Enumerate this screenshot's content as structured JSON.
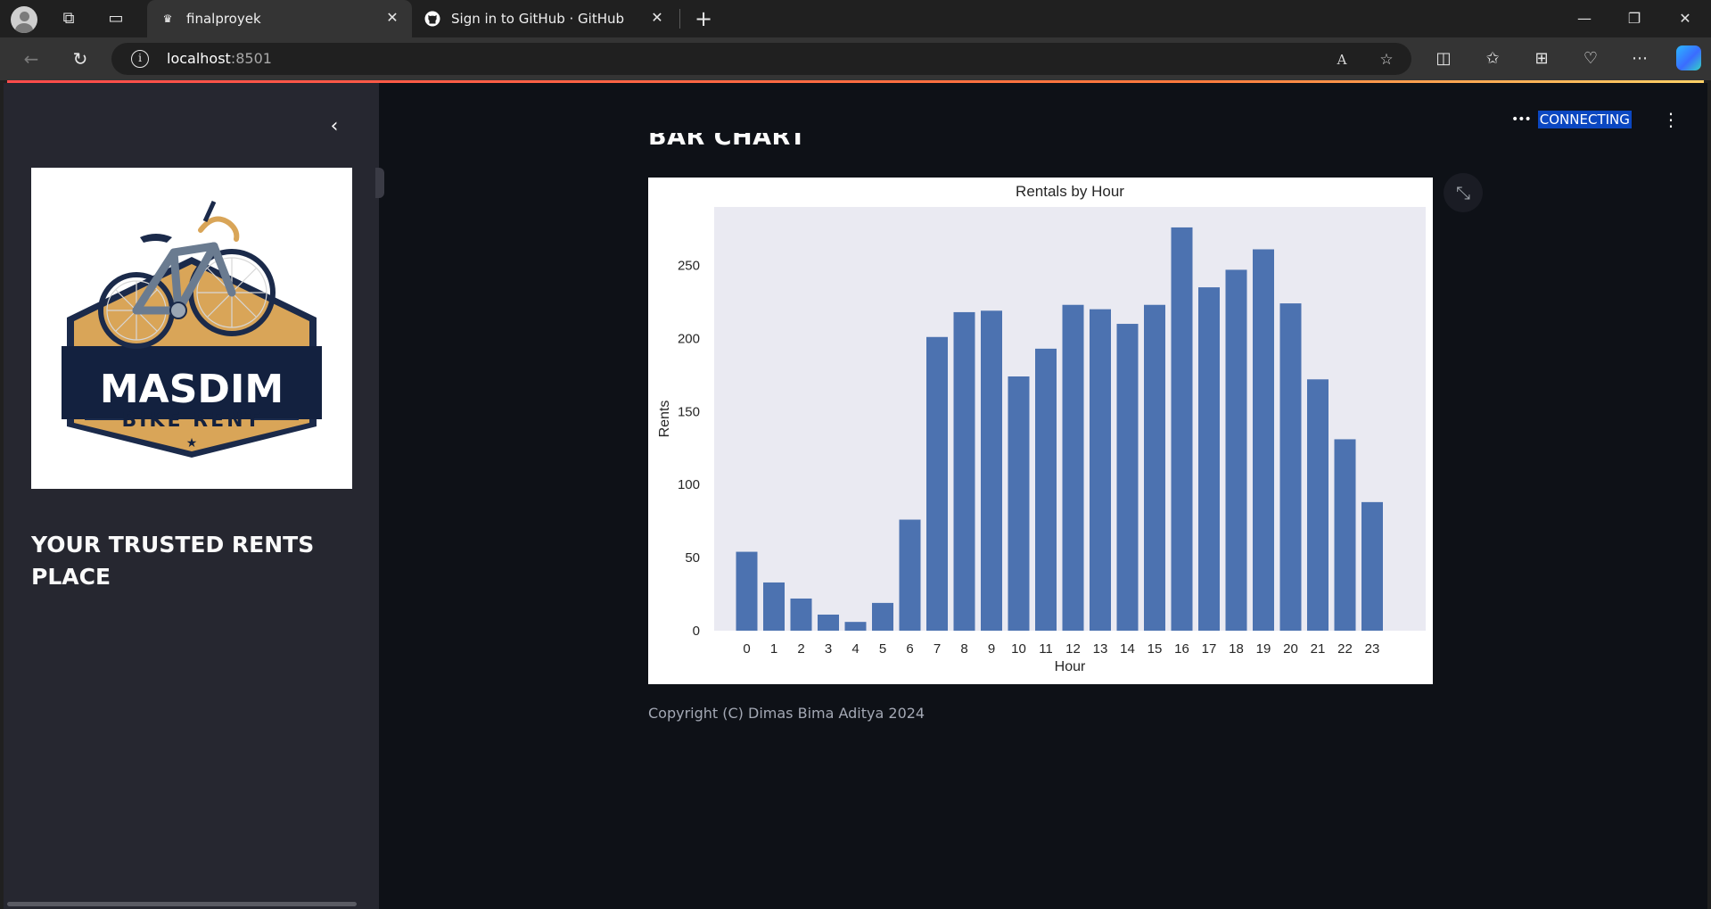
{
  "browser": {
    "tabs": [
      {
        "title": "finalproyek",
        "active": true
      },
      {
        "title": "Sign in to GitHub · GitHub",
        "active": false
      }
    ],
    "address": {
      "host": "localhost",
      "port": ":8501"
    }
  },
  "sidebar": {
    "logo": {
      "brand": "MASDIM",
      "subtitle": "BIKE RENT"
    },
    "tagline": "YOUR TRUSTED RENTS PLACE"
  },
  "header": {
    "status": "CONNECTING"
  },
  "main": {
    "section_title": "BAR CHART",
    "footer": "Copyright (C) Dimas Bima Aditya 2024"
  },
  "chart_data": {
    "type": "bar",
    "title": "Rentals by Hour",
    "xlabel": "Hour",
    "ylabel": "Rents",
    "categories": [
      "0",
      "1",
      "2",
      "3",
      "4",
      "5",
      "6",
      "7",
      "8",
      "9",
      "10",
      "11",
      "12",
      "13",
      "14",
      "15",
      "16",
      "17",
      "18",
      "19",
      "20",
      "21",
      "22",
      "23"
    ],
    "values": [
      54,
      33,
      22,
      11,
      6,
      19,
      76,
      201,
      218,
      219,
      174,
      193,
      223,
      220,
      210,
      223,
      276,
      235,
      247,
      261,
      224,
      172,
      131,
      88
    ],
    "yticks": [
      0,
      50,
      100,
      150,
      200,
      250
    ],
    "ylim": [
      0,
      290
    ],
    "bar_color": "#4c72b0",
    "plot_background": "#eaeaf2",
    "grid": false
  },
  "colors": {
    "page_background": "#0e1117",
    "sidebar_background": "#262730",
    "status_highlight": "#0b47c1"
  }
}
